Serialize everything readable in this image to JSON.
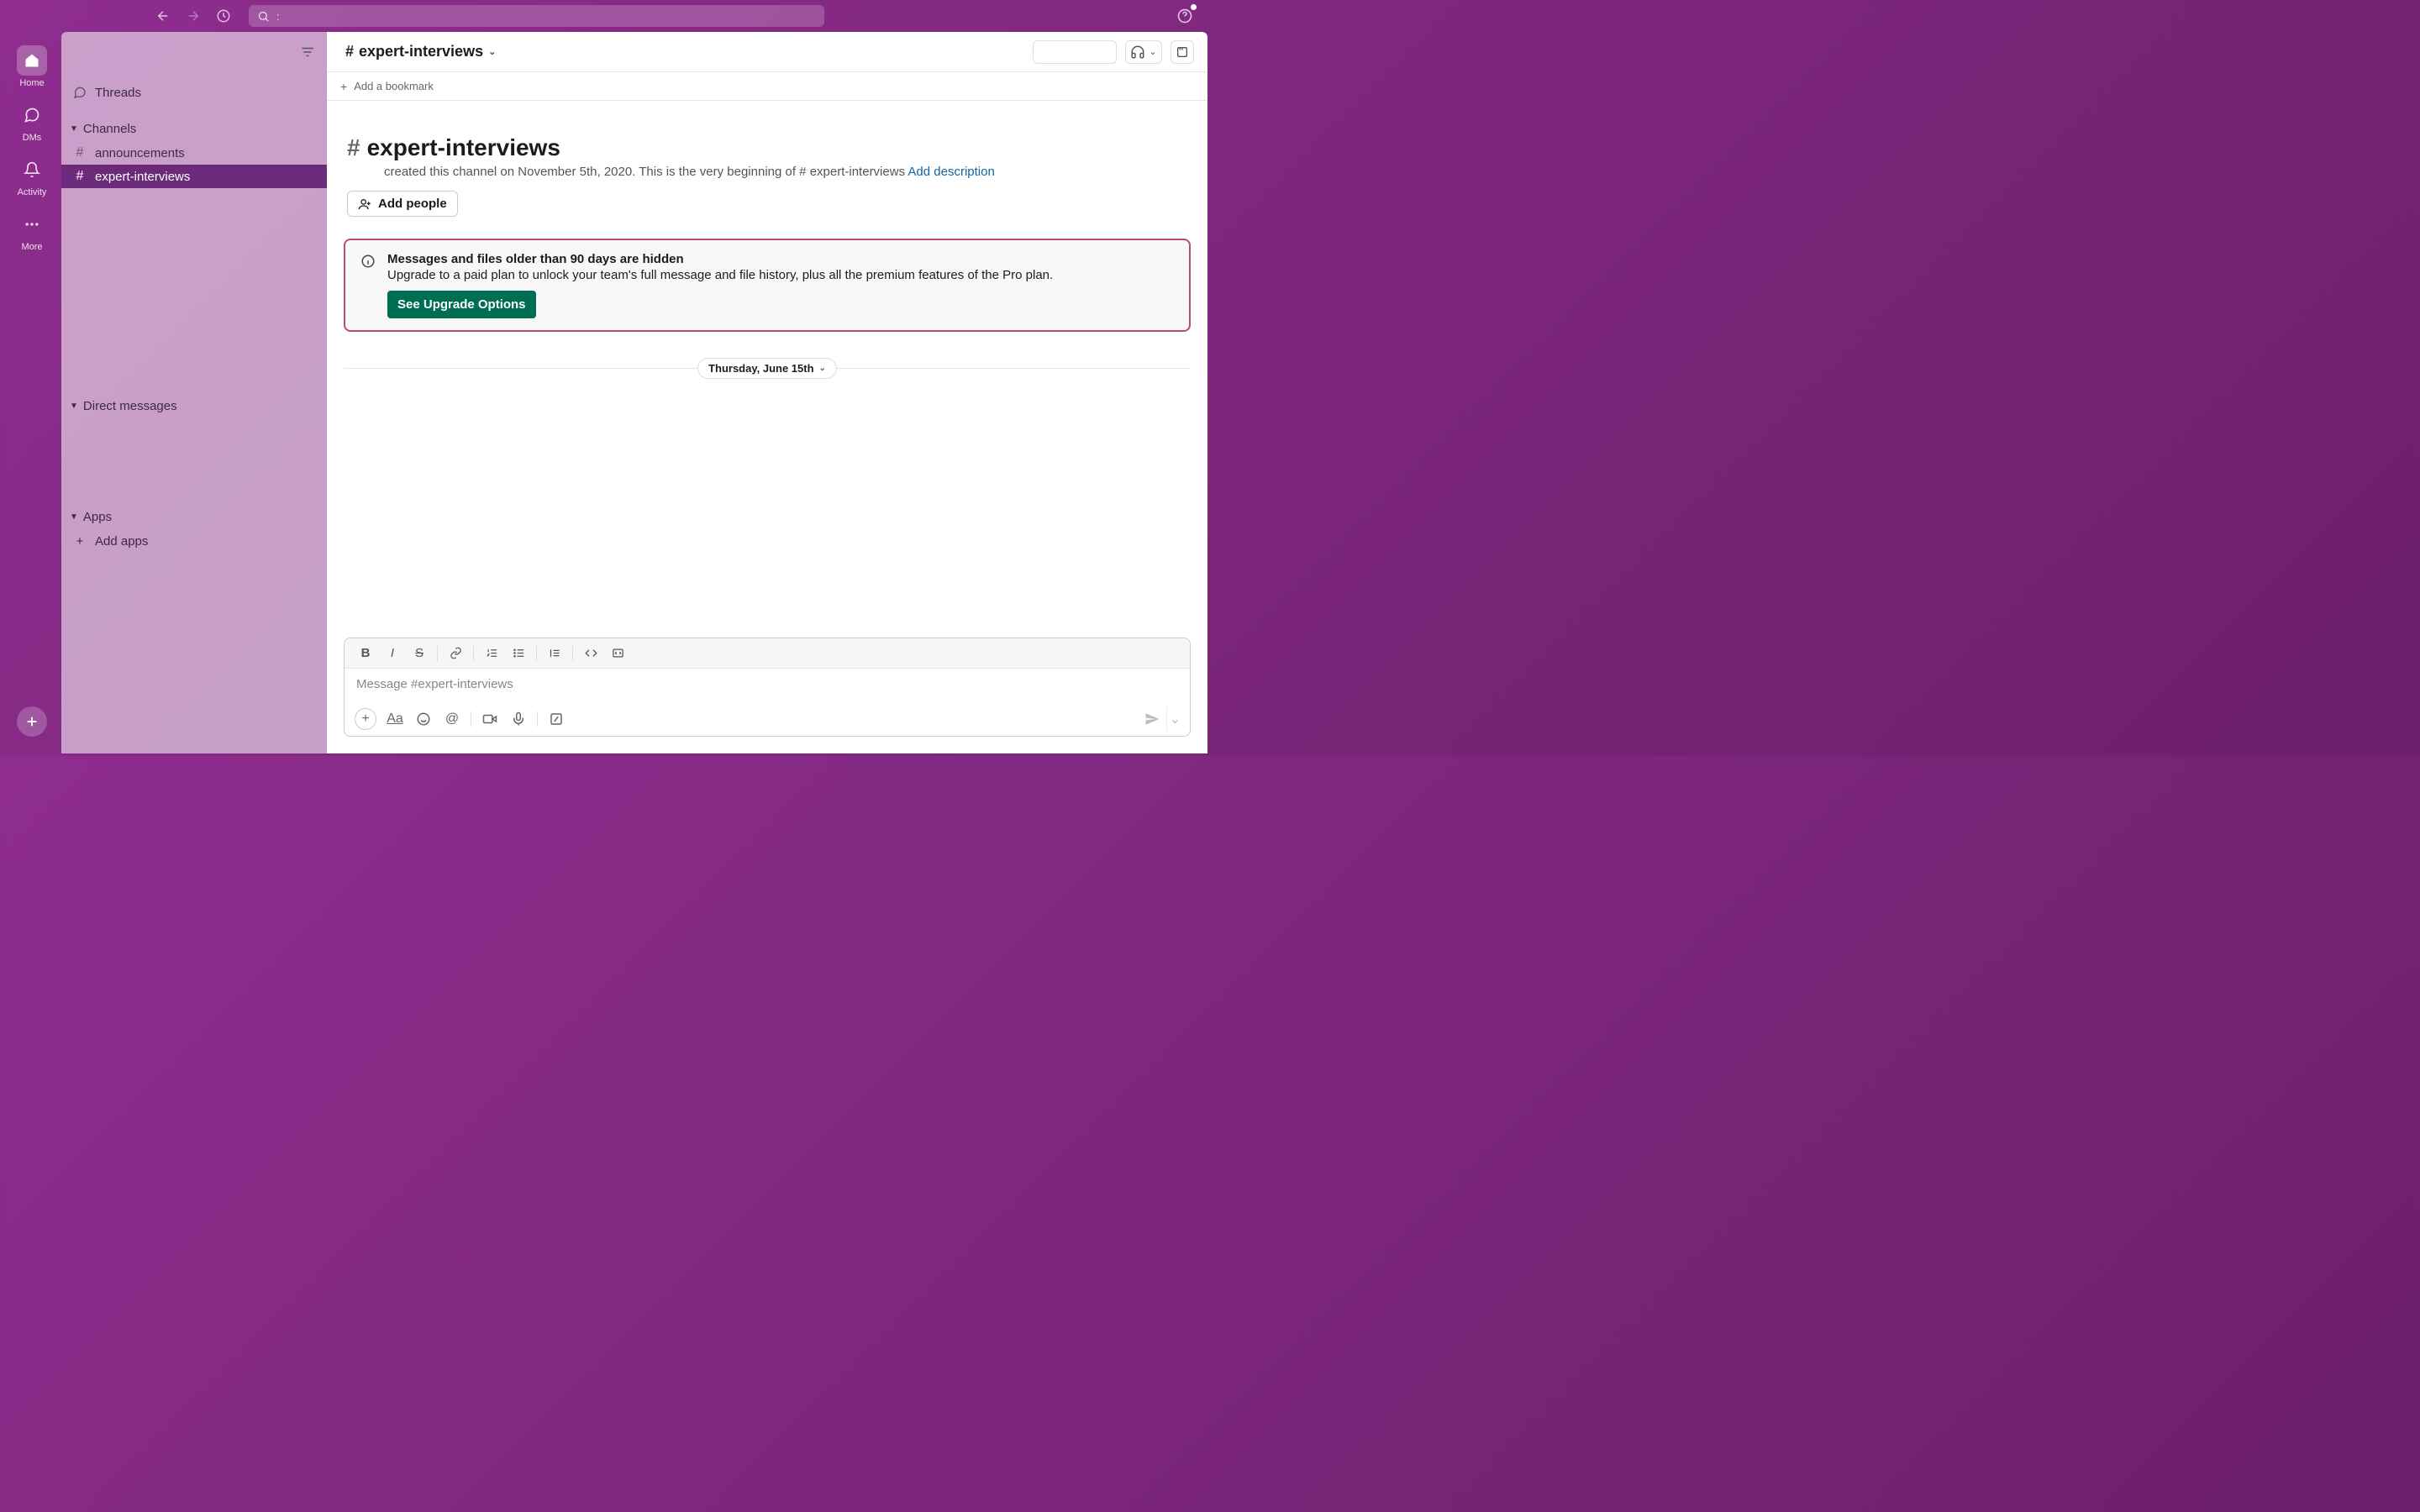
{
  "colors": {
    "accent": "#6b2b7a",
    "upgrade_border": "#b84a7d",
    "upgrade_btn": "#006e52",
    "link": "#1264a3"
  },
  "topbar": {
    "search_placeholder": ":"
  },
  "rail": {
    "items": [
      {
        "id": "home",
        "label": "Home"
      },
      {
        "id": "dms",
        "label": "DMs"
      },
      {
        "id": "activity",
        "label": "Activity"
      },
      {
        "id": "more",
        "label": "More"
      }
    ]
  },
  "sidebar": {
    "threads_label": "Threads",
    "channels_header": "Channels",
    "channels": [
      {
        "name": "announcements",
        "active": false
      },
      {
        "name": "expert-interviews",
        "active": true
      }
    ],
    "dms_header": "Direct messages",
    "apps_header": "Apps",
    "add_apps_label": "Add apps"
  },
  "header": {
    "channel_name": "expert-interviews",
    "add_bookmark_label": "Add a bookmark"
  },
  "hero": {
    "channel_name": "expert-interviews",
    "created_text": "created this channel on November 5th, 2020. This is the very beginning of # expert-interviews ",
    "add_description_label": "Add description",
    "add_people_label": "Add people"
  },
  "banner": {
    "title": "Messages and files older than 90 days are hidden",
    "body": "Upgrade to a paid plan to unlock your team's full message and file history, plus all the premium features of the Pro plan.",
    "button_label": "See Upgrade Options"
  },
  "date_divider": "Thursday, June 15th",
  "composer": {
    "placeholder": "Message #expert-interviews"
  }
}
